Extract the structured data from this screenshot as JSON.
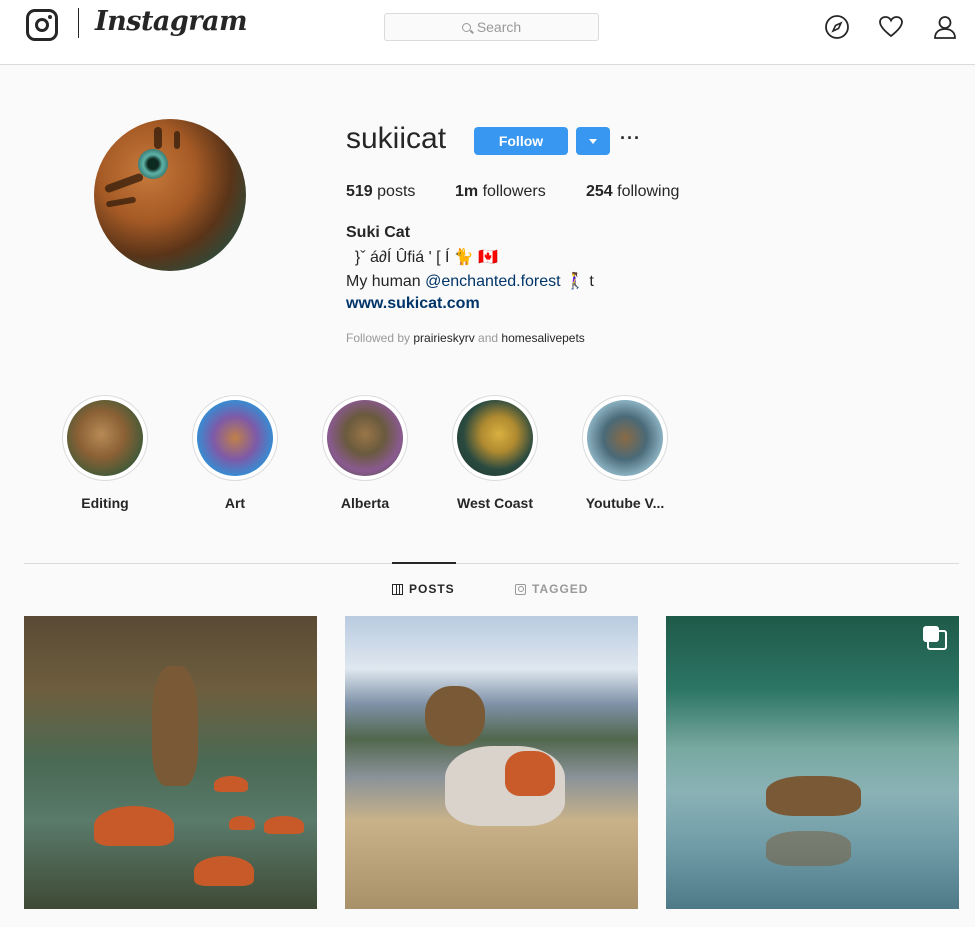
{
  "header": {
    "wordmark": "Instagram",
    "search_placeholder": "Search",
    "icons": [
      "instagram-glyph-icon",
      "compass-icon",
      "heart-icon",
      "person-icon"
    ]
  },
  "profile": {
    "username": "sukiicat",
    "follow_label": "Follow",
    "more_label": "···",
    "stats": {
      "posts_count": "519",
      "posts_label": " posts",
      "followers_count": "1m",
      "followers_label": " followers",
      "following_count": "254",
      "following_label": " following"
    },
    "full_name": "Suki Cat",
    "bio_line1": "  }ˇ á∂Í Ûfiá ' [ Í 🐈 🇨🇦",
    "bio_line2_prefix": "My human ",
    "bio_mention": "@enchanted.forest",
    "bio_line2_suffix": " 🚶‍♀️ t",
    "website": "www.sukicat.com",
    "followed_by_prefix": "Followed by ",
    "followed_by_1": "prairieskyrv",
    "followed_by_and": " and ",
    "followed_by_2": "homesalivepets"
  },
  "highlights": [
    {
      "label": "Editing"
    },
    {
      "label": "Art"
    },
    {
      "label": "Alberta"
    },
    {
      "label": "West Coast"
    },
    {
      "label": "Youtube V..."
    }
  ],
  "tabs": {
    "posts": "POSTS",
    "tagged": "TAGGED"
  },
  "colors": {
    "accent": "#3897f0",
    "link": "#003569",
    "muted": "#999999",
    "border": "#dbdbdb"
  }
}
